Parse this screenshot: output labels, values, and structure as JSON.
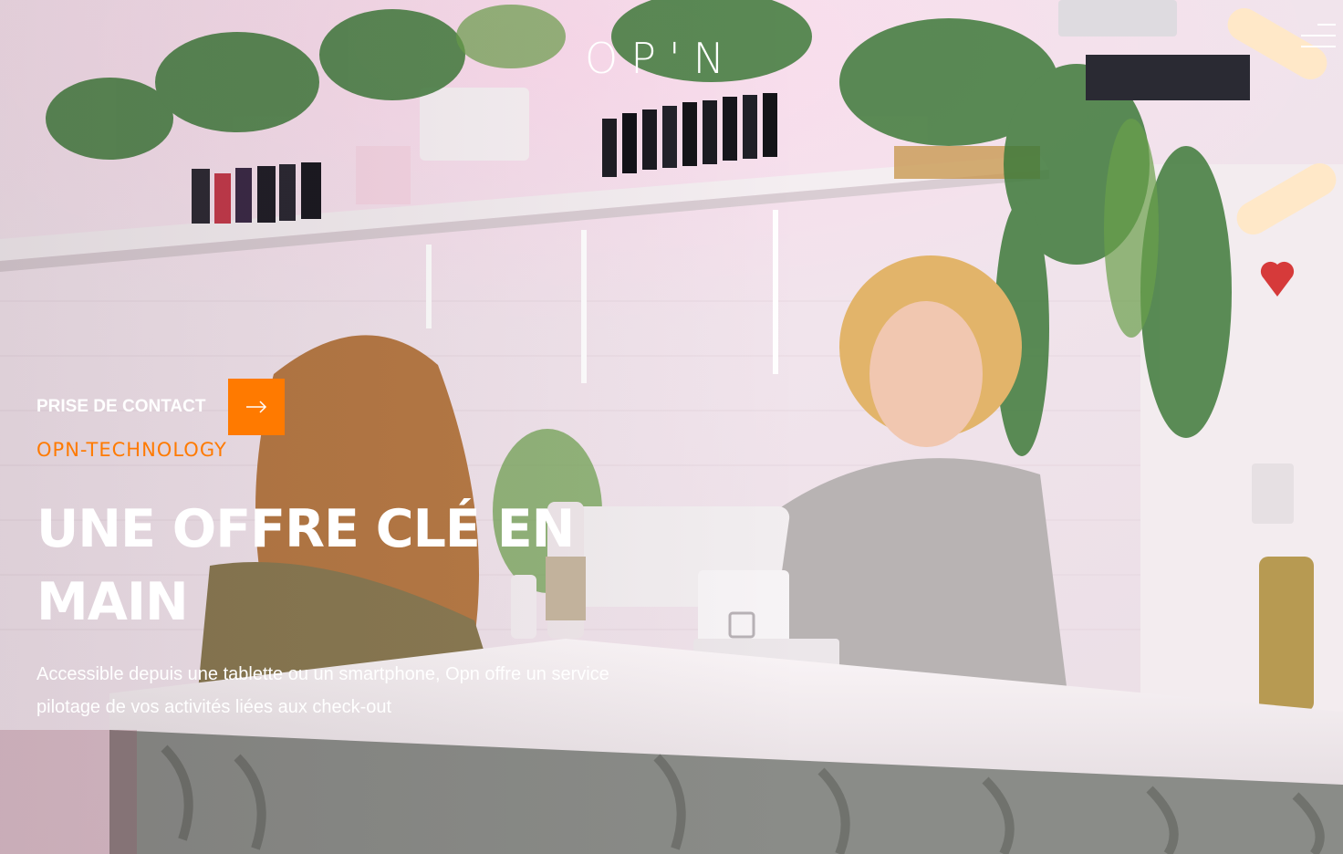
{
  "brand": {
    "logo_text": "OP'N"
  },
  "header": {
    "menu_icon": "hamburger-menu-icon"
  },
  "hero": {
    "contact_label": "PRISE DE CONTACT",
    "contact_icon": "arrow-right-icon",
    "eyebrow": "OPN-TECHNOLOGY",
    "headline": "UNE OFFRE CLÉ EN MAIN",
    "description": "Accessible depuis une tablette ou un smartphone, Opn offre un service pilotage de vos activités liées aux check-out"
  },
  "colors": {
    "accent": "#ff7a00",
    "text": "#ffffff"
  }
}
